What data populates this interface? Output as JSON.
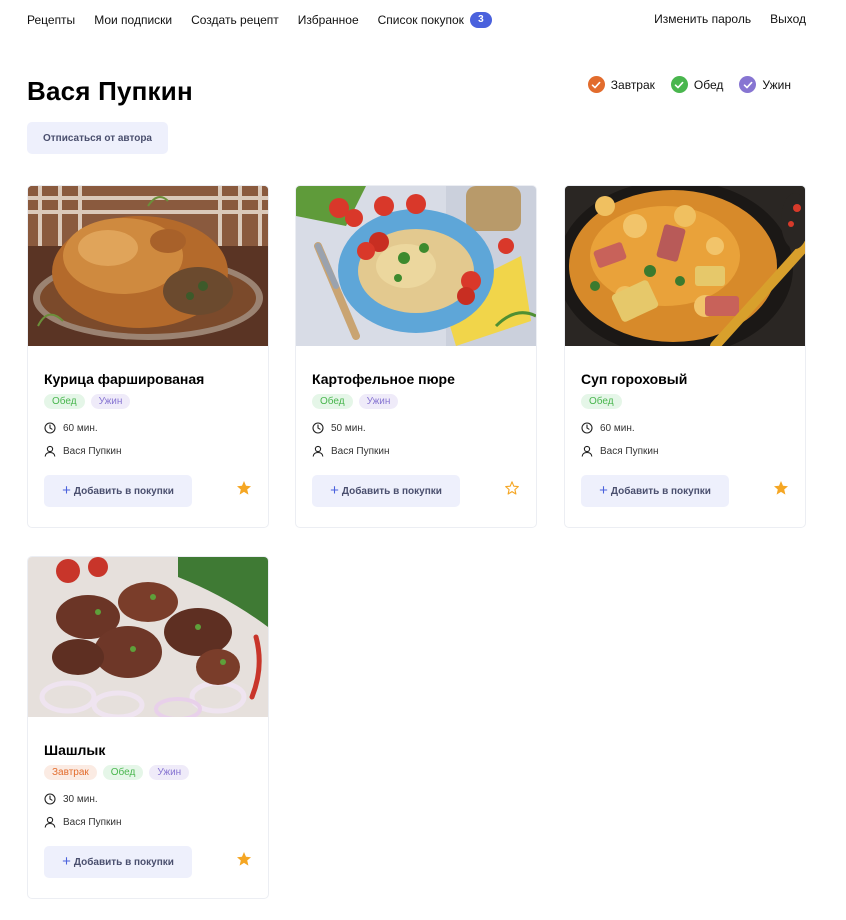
{
  "nav": {
    "links": [
      {
        "label": "Рецепты"
      },
      {
        "label": "Мои подписки"
      },
      {
        "label": "Создать рецепт"
      },
      {
        "label": "Избранное"
      },
      {
        "label": "Список покупок"
      }
    ],
    "cart_count": "3",
    "change_password": "Изменить пароль",
    "logout": "Выход"
  },
  "page": {
    "title": "Вася Пупкин",
    "unsubscribe_label": "Отписаться от автора"
  },
  "filters": [
    {
      "label": "Завтрак",
      "color": "#e26c2d"
    },
    {
      "label": "Обед",
      "color": "#49b64e"
    },
    {
      "label": "Ужин",
      "color": "#8775d2"
    }
  ],
  "add_label": "Добавить в покупки",
  "cards": [
    {
      "title": "Курица фаршированая",
      "tags": [
        "Обед",
        "Ужин"
      ],
      "time": "60 мин.",
      "author": "Вася Пупкин",
      "favorite": true,
      "image": "roasted-chicken"
    },
    {
      "title": "Картофельное пюре",
      "tags": [
        "Обед",
        "Ужин"
      ],
      "time": "50 мин.",
      "author": "Вася Пупкин",
      "favorite": false,
      "image": "mashed-potatoes"
    },
    {
      "title": "Суп гороховый",
      "tags": [
        "Обед"
      ],
      "time": "60 мин.",
      "author": "Вася Пупкин",
      "favorite": true,
      "image": "pea-soup"
    },
    {
      "title": "Шашлык",
      "tags": [
        "Завтрак",
        "Обед",
        "Ужин"
      ],
      "time": "30 мин.",
      "author": "Вася Пупкин",
      "favorite": true,
      "image": "shashlik"
    }
  ]
}
